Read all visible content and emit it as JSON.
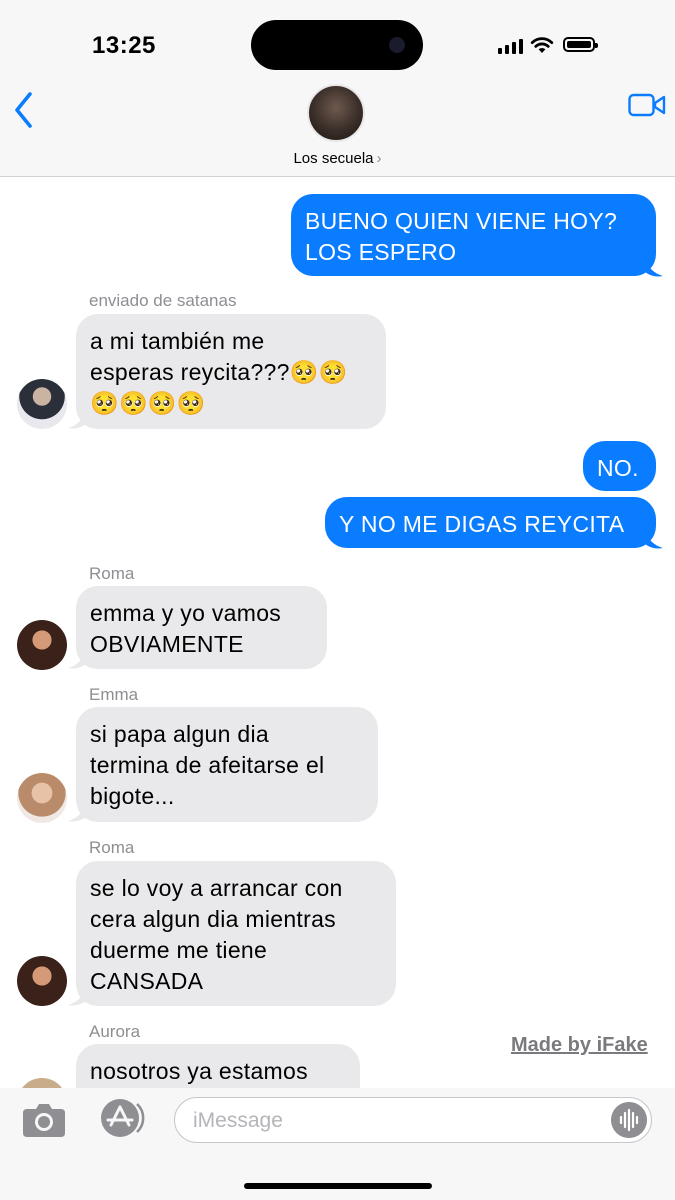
{
  "status_bar": {
    "time": "13:25"
  },
  "header": {
    "group_name": "Los secuela",
    "chevron": "›"
  },
  "messages": [
    {
      "type": "out",
      "text": "BUENO QUIEN VIENE HOY?\nLOS ESPERO"
    },
    {
      "type": "in",
      "sender": "enviado de satanas",
      "text": "a mi también me\nesperas reycita???🥺🥺\n🥺🥺🥺🥺"
    },
    {
      "type": "out",
      "text": "NO."
    },
    {
      "type": "out",
      "text": "Y NO ME DIGAS REYCITA"
    },
    {
      "type": "in",
      "sender": "Roma",
      "text": "emma y yo vamos\nOBVIAMENTE"
    },
    {
      "type": "in",
      "sender": "Emma",
      "text": "si papa algun dia\ntermina de afeitarse el\nbigote..."
    },
    {
      "type": "in",
      "sender": "Roma",
      "text": "se lo voy a arrancar con\ncera algun dia mientras\nduerme me tiene\nCANSADA"
    },
    {
      "type": "in",
      "sender": "Aurora",
      "text": "nosotros ya estamos"
    }
  ],
  "watermark": "Made by iFake",
  "input": {
    "placeholder": "iMessage"
  },
  "colors": {
    "outgoing_bubble": "#0a7cff",
    "incoming_bubble": "#e9e9eb",
    "accent": "#0a7cff"
  },
  "icons": [
    "back-chevron-icon",
    "video-camera-icon",
    "camera-icon",
    "app-store-icon",
    "voice-waveform-icon"
  ]
}
